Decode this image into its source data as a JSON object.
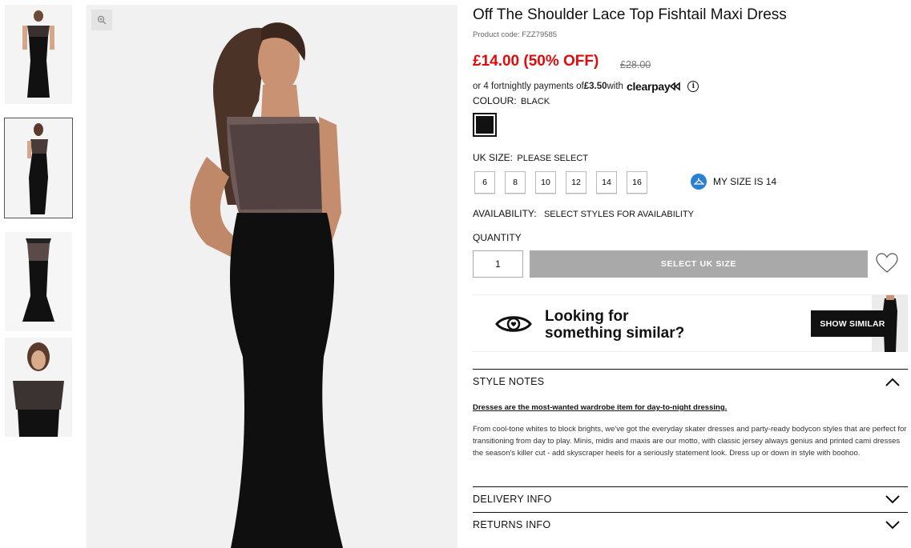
{
  "product": {
    "title": "Off The Shoulder Lace Top Fishtail Maxi Dress",
    "code": "Product code: FZZ79585",
    "price": "£14.00 (50% OFF)",
    "old_price": "£28.00"
  },
  "clearpay": {
    "prefix": "or 4 fortnightly payments of ",
    "amount": "£3.50",
    "suffix": " with",
    "logo": "clearpay",
    "info": "i"
  },
  "colour": {
    "label": "COLOUR:",
    "value": "BLACK",
    "swatch_color": "#111111"
  },
  "size": {
    "label": "UK SIZE:",
    "value": "PLEASE SELECT",
    "options": [
      "6",
      "8",
      "10",
      "12",
      "14",
      "16"
    ],
    "my_size": "MY SIZE IS 14"
  },
  "availability": {
    "label": "AVAILABILITY:",
    "value": "SELECT STYLES FOR AVAILABILITY"
  },
  "quantity": {
    "label": "QUANTITY",
    "value": "1"
  },
  "add_button": "SELECT UK SIZE",
  "similar": {
    "line1": "Looking for",
    "line2": "something similar?",
    "button": "SHOW SIMILAR"
  },
  "accordions": {
    "style_notes": "STYLE NOTES",
    "delivery": "DELIVERY INFO",
    "returns": "RETURNS INFO"
  },
  "notes": {
    "lead": "Dresses are the most-wanted wardrobe item for day-to-night dressing.",
    "body": "From cool-tone whites to block brights, we've got the everyday skater dresses and party-ready bodycon styles that are perfect for transitioning from day to play. Minis, midis and maxis are our motto, with classic jersey always genius and printed cami dresses the season's killer cut - add skyscraper heels for a seriously statement look. Dress up or down in style with boohoo."
  },
  "colors": {
    "price_red": "#e20b0b",
    "button_grey": "#a9a9a9",
    "clearpay_blue": "#2d7fd3"
  }
}
